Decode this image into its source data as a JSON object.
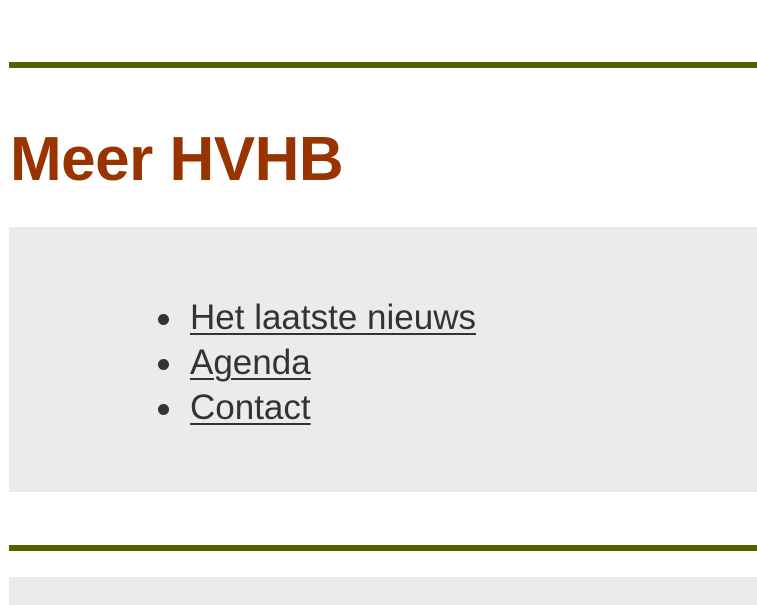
{
  "colors": {
    "accent_rule": "#536100",
    "heading": "#993300",
    "panel_background": "#ebebeb",
    "link_text": "#333333"
  },
  "section": {
    "title": "Meer HVHB"
  },
  "menu": {
    "items": [
      {
        "label": "Het laatste nieuws"
      },
      {
        "label": "Agenda"
      },
      {
        "label": "Contact"
      }
    ]
  }
}
